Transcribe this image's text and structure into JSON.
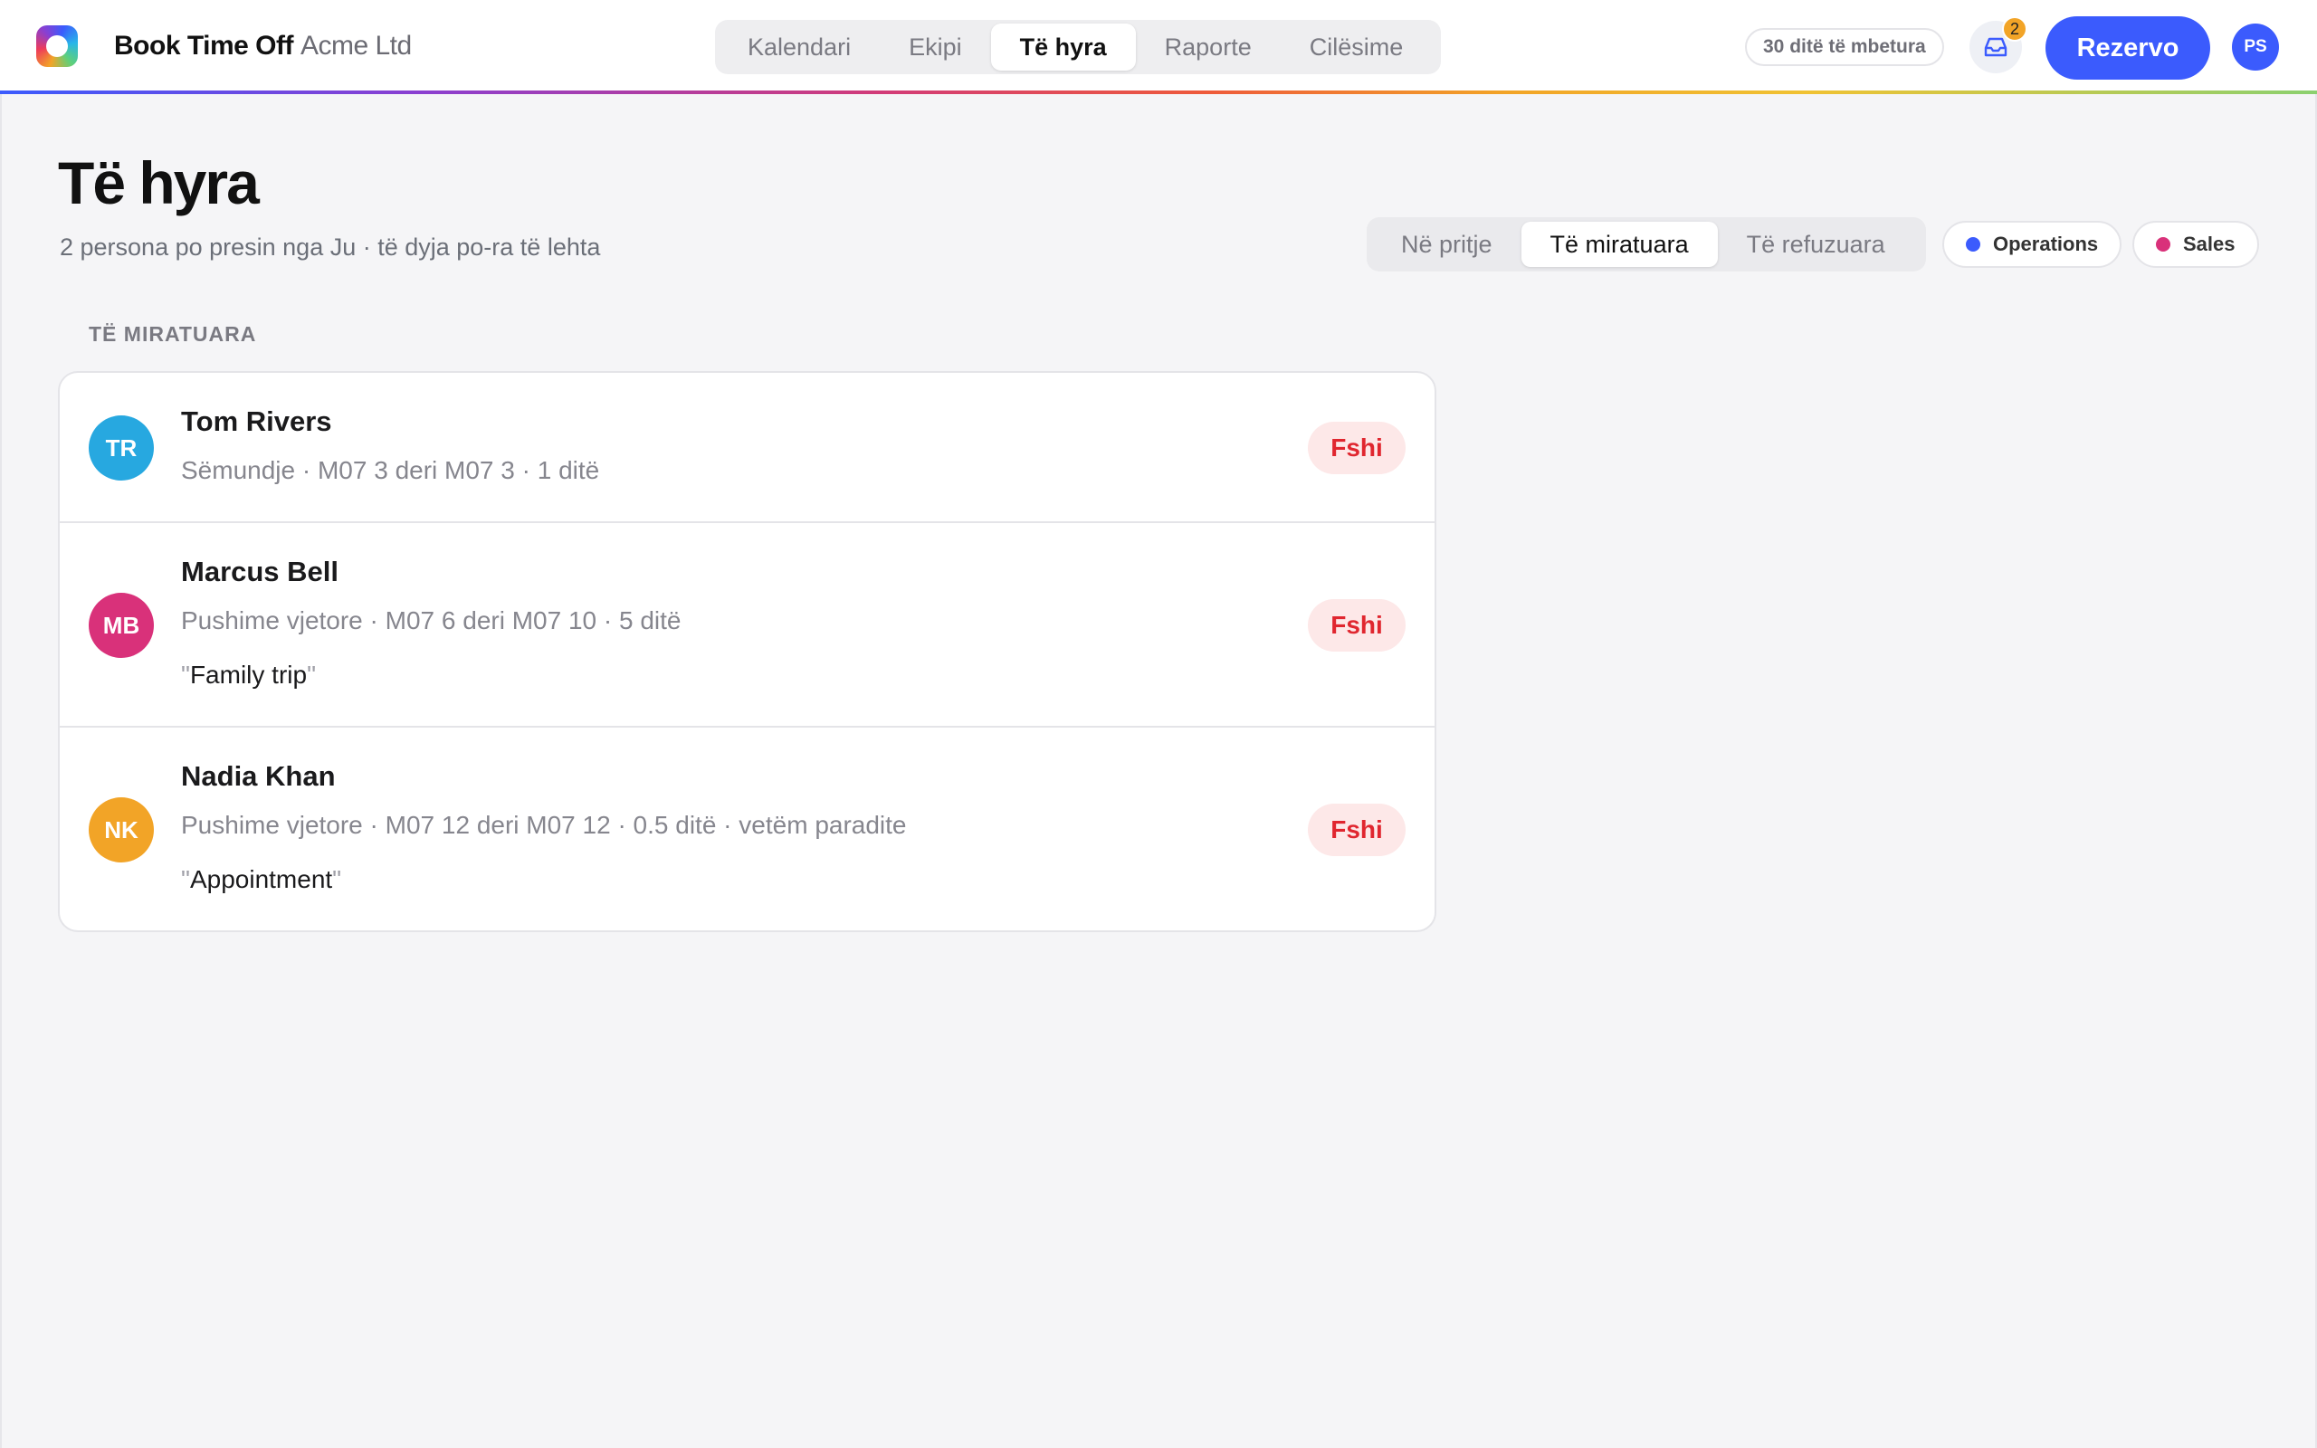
{
  "app": {
    "brand": "Book Time Off",
    "org": "Acme Ltd"
  },
  "nav": {
    "tabs": [
      {
        "label": "Kalendari",
        "active": false
      },
      {
        "label": "Ekipi",
        "active": false
      },
      {
        "label": "Të hyra",
        "active": true
      },
      {
        "label": "Raporte",
        "active": false
      },
      {
        "label": "Cilësime",
        "active": false
      }
    ]
  },
  "header": {
    "days_remaining": "30 ditë të mbetura",
    "inbox_count": "2",
    "book_label": "Rezervo",
    "user_initials": "PS"
  },
  "page": {
    "title": "Të hyra",
    "subtitle": "2 persona po presin nga Ju · të dyja po-ra të lehta"
  },
  "status_filter": {
    "options": [
      {
        "label": "Në pritje",
        "active": false
      },
      {
        "label": "Të miratuara",
        "active": true
      },
      {
        "label": "Të refuzuara",
        "active": false
      }
    ]
  },
  "team_chips": [
    {
      "label": "Operations",
      "color": "#3b5bfd"
    },
    {
      "label": "Sales",
      "color": "#d9317a"
    }
  ],
  "section": {
    "label": "TË MIRATUARA"
  },
  "requests": [
    {
      "initials": "TR",
      "avatar_color": "#27a8e0",
      "name": "Tom Rivers",
      "meta": "Sëmundje · M07 3 deri M07 3 · 1 ditë",
      "note": "",
      "action": "Fshi"
    },
    {
      "initials": "MB",
      "avatar_color": "#d9317a",
      "name": "Marcus Bell",
      "meta": "Pushime vjetore · M07 6 deri M07 10 · 5 ditë",
      "note": "Family trip",
      "action": "Fshi"
    },
    {
      "initials": "NK",
      "avatar_color": "#f2a427",
      "name": "Nadia Khan",
      "meta": "Pushime vjetore · M07 12 deri M07 12 · 0.5 ditë · vetëm paradite",
      "note": "Appointment",
      "action": "Fshi"
    }
  ],
  "quote_mark": "\""
}
